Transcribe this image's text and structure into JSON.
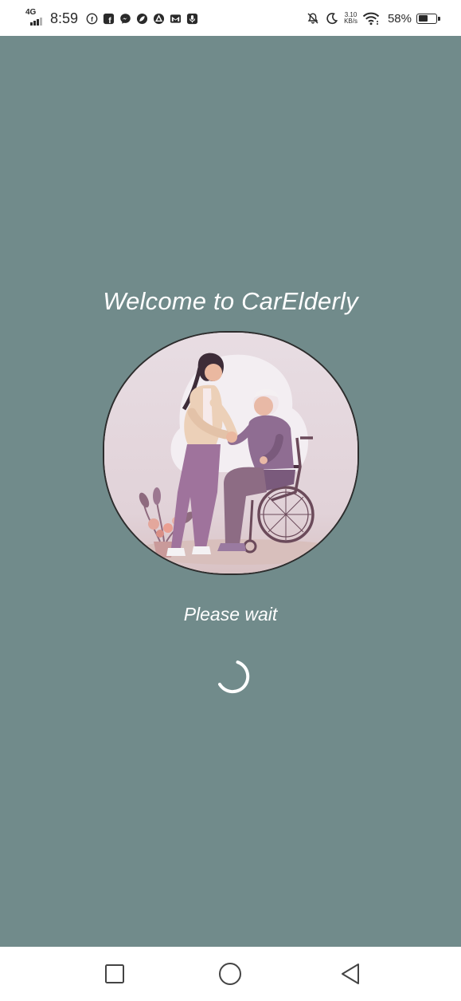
{
  "status_bar": {
    "network": "4G",
    "time": "8:59",
    "net_speed_value": "3.10",
    "net_speed_unit": "KB/s",
    "battery": "58%",
    "battery_level": 0.58,
    "notification_icons": [
      "facebook-icon",
      "facebook-square-icon",
      "messenger-icon",
      "leaf-app-icon",
      "triangle-app-icon",
      "gmail-icon",
      "microphone-app-icon"
    ],
    "right_icons": [
      "bell-off-icon",
      "moon-icon",
      "wifi-icon"
    ]
  },
  "screen": {
    "background": "#718b8b",
    "title": "Welcome to CarElderly",
    "image_icon": "caregiver-elderly-illustration",
    "status": "Please wait",
    "spinner_icon": "loading-spinner-icon"
  },
  "nav_bar": {
    "recent_icon": "square-recent-apps-icon",
    "home_icon": "circle-home-icon",
    "back_icon": "triangle-back-icon"
  }
}
